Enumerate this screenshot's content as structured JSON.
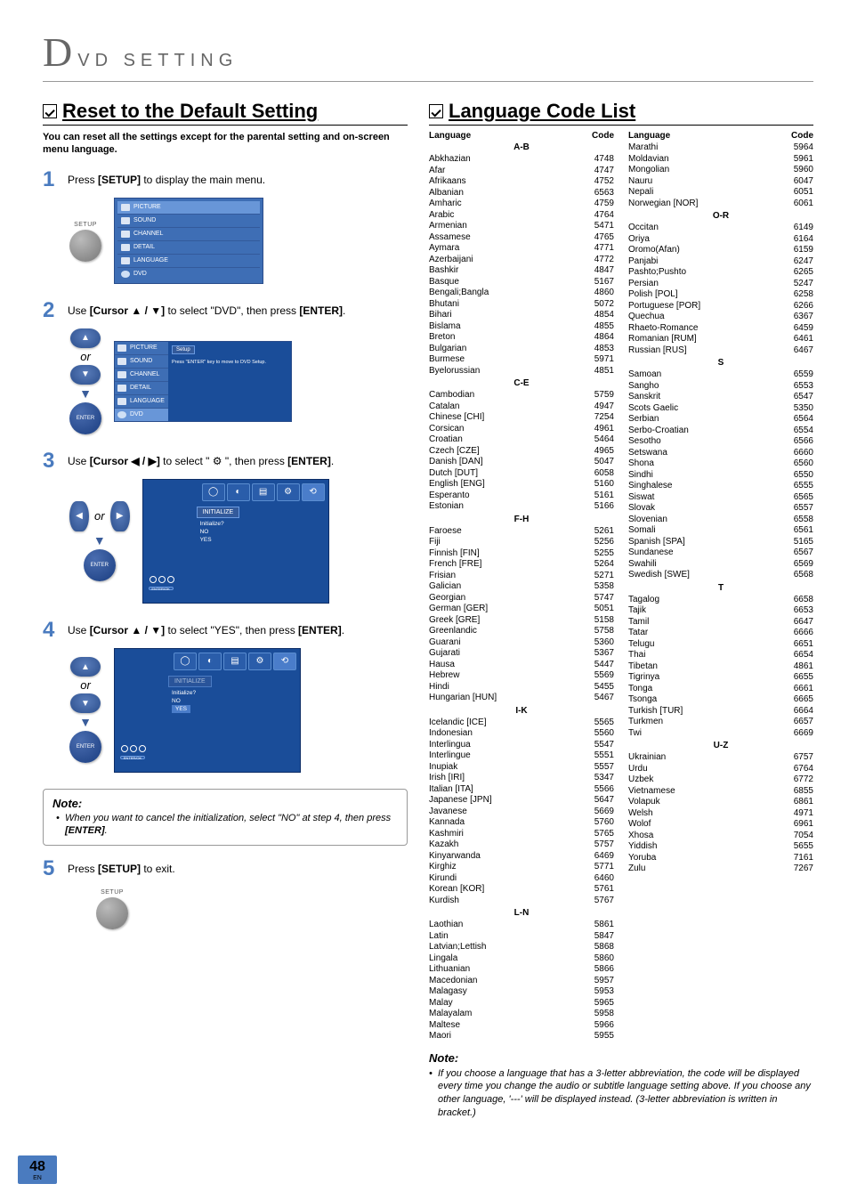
{
  "header": {
    "bigLetter": "D",
    "title": "VD   SETTING"
  },
  "leftSection": {
    "title": "Reset to the Default Setting",
    "intro": "You can reset all the settings except for the parental setting and on-screen menu language.",
    "steps": {
      "s1": {
        "num": "1",
        "text_pre": "Press ",
        "key1": "[SETUP]",
        "text_post": " to display the main menu.",
        "btnLabel": "SETUP"
      },
      "s2": {
        "num": "2",
        "text_pre": "Use ",
        "key1": "[Cursor ▲ / ▼]",
        "mid": " to select \"DVD\", then press ",
        "key2": "[ENTER]",
        "end": ".",
        "or": "or",
        "enter": "ENTER"
      },
      "s3": {
        "num": "3",
        "text_pre": "Use ",
        "key1": "[Cursor ◀ / ▶]",
        "mid": " to select \" ",
        "icon": "⚙",
        "mid2": " \", then press ",
        "key2": "[ENTER]",
        "end": ".",
        "or": "or",
        "enter": "ENTER"
      },
      "s4": {
        "num": "4",
        "text_pre": "Use ",
        "key1": "[Cursor ▲ / ▼]",
        "mid": " to select \"YES\", then press ",
        "key2": "[ENTER]",
        "end": ".",
        "or": "or",
        "enter": "ENTER"
      },
      "s5": {
        "num": "5",
        "text_pre": "Press ",
        "key1": "[SETUP]",
        "text_post": " to exit.",
        "btnLabel": "SETUP"
      }
    },
    "menu": {
      "items": [
        "PICTURE",
        "SOUND",
        "CHANNEL",
        "DETAIL",
        "LANGUAGE",
        "DVD"
      ]
    },
    "screen2": {
      "setupLabel": "Setup",
      "hint": "Press \"ENTER\" key to move to DVD Setup."
    },
    "dvdSetup": {
      "initialize": "INITIALIZE",
      "question": "Initialize?",
      "no": "NO",
      "yes": "YES",
      "enterOk": "ENTER/OK"
    },
    "note": {
      "title": "Note:",
      "item": "When you want to cancel the initialization, select \"NO\" at step 4, then press ",
      "key": "[ENTER]",
      "end": "."
    }
  },
  "rightSection": {
    "title": "Language Code List",
    "headerLang": "Language",
    "headerCode": "Code",
    "groups": {
      "col1": [
        {
          "g": "A-B"
        },
        {
          "l": "Abkhazian",
          "c": "4748"
        },
        {
          "l": "Afar",
          "c": "4747"
        },
        {
          "l": "Afrikaans",
          "c": "4752"
        },
        {
          "l": "Albanian",
          "c": "6563"
        },
        {
          "l": "Amharic",
          "c": "4759"
        },
        {
          "l": "Arabic",
          "c": "4764"
        },
        {
          "l": "Armenian",
          "c": "5471"
        },
        {
          "l": "Assamese",
          "c": "4765"
        },
        {
          "l": "Aymara",
          "c": "4771"
        },
        {
          "l": "Azerbaijani",
          "c": "4772"
        },
        {
          "l": "Bashkir",
          "c": "4847"
        },
        {
          "l": "Basque",
          "c": "5167"
        },
        {
          "l": "Bengali;Bangla",
          "c": "4860"
        },
        {
          "l": "Bhutani",
          "c": "5072"
        },
        {
          "l": "Bihari",
          "c": "4854"
        },
        {
          "l": "Bislama",
          "c": "4855"
        },
        {
          "l": "Breton",
          "c": "4864"
        },
        {
          "l": "Bulgarian",
          "c": "4853"
        },
        {
          "l": "Burmese",
          "c": "5971"
        },
        {
          "l": "Byelorussian",
          "c": "4851"
        },
        {
          "g": "C-E"
        },
        {
          "l": "Cambodian",
          "c": "5759"
        },
        {
          "l": "Catalan",
          "c": "4947"
        },
        {
          "l": "Chinese [CHI]",
          "c": "7254"
        },
        {
          "l": "Corsican",
          "c": "4961"
        },
        {
          "l": "Croatian",
          "c": "5464"
        },
        {
          "l": "Czech [CZE]",
          "c": "4965"
        },
        {
          "l": "Danish [DAN]",
          "c": "5047"
        },
        {
          "l": "Dutch [DUT]",
          "c": "6058"
        },
        {
          "l": "English [ENG]",
          "c": "5160"
        },
        {
          "l": "Esperanto",
          "c": "5161"
        },
        {
          "l": "Estonian",
          "c": "5166"
        },
        {
          "g": "F-H"
        },
        {
          "l": "Faroese",
          "c": "5261"
        },
        {
          "l": "Fiji",
          "c": "5256"
        },
        {
          "l": "Finnish [FIN]",
          "c": "5255"
        },
        {
          "l": "French [FRE]",
          "c": "5264"
        },
        {
          "l": "Frisian",
          "c": "5271"
        },
        {
          "l": "Galician",
          "c": "5358"
        },
        {
          "l": "Georgian",
          "c": "5747"
        },
        {
          "l": "German [GER]",
          "c": "5051"
        },
        {
          "l": "Greek [GRE]",
          "c": "5158"
        },
        {
          "l": "Greenlandic",
          "c": "5758"
        },
        {
          "l": "Guarani",
          "c": "5360"
        },
        {
          "l": "Gujarati",
          "c": "5367"
        },
        {
          "l": "Hausa",
          "c": "5447"
        },
        {
          "l": "Hebrew",
          "c": "5569"
        },
        {
          "l": "Hindi",
          "c": "5455"
        },
        {
          "l": "Hungarian [HUN]",
          "c": "5467"
        },
        {
          "g": "I-K"
        },
        {
          "l": "Icelandic [ICE]",
          "c": "5565"
        },
        {
          "l": "Indonesian",
          "c": "5560"
        },
        {
          "l": "Interlingua",
          "c": "5547"
        },
        {
          "l": "Interlingue",
          "c": "5551"
        },
        {
          "l": "Inupiak",
          "c": "5557"
        },
        {
          "l": "Irish [IRI]",
          "c": "5347"
        },
        {
          "l": "Italian [ITA]",
          "c": "5566"
        },
        {
          "l": "Japanese [JPN]",
          "c": "5647"
        },
        {
          "l": "Javanese",
          "c": "5669"
        },
        {
          "l": "Kannada",
          "c": "5760"
        },
        {
          "l": "Kashmiri",
          "c": "5765"
        },
        {
          "l": "Kazakh",
          "c": "5757"
        },
        {
          "l": "Kinyarwanda",
          "c": "6469"
        },
        {
          "l": "Kirghiz",
          "c": "5771"
        },
        {
          "l": "Kirundi",
          "c": "6460"
        },
        {
          "l": "Korean [KOR]",
          "c": "5761"
        },
        {
          "l": "Kurdish",
          "c": "5767"
        },
        {
          "g": "L-N"
        },
        {
          "l": "Laothian",
          "c": "5861"
        },
        {
          "l": "Latin",
          "c": "5847"
        },
        {
          "l": "Latvian;Lettish",
          "c": "5868"
        },
        {
          "l": "Lingala",
          "c": "5860"
        },
        {
          "l": "Lithuanian",
          "c": "5866"
        },
        {
          "l": "Macedonian",
          "c": "5957"
        },
        {
          "l": "Malagasy",
          "c": "5953"
        },
        {
          "l": "Malay",
          "c": "5965"
        },
        {
          "l": "Malayalam",
          "c": "5958"
        },
        {
          "l": "Maltese",
          "c": "5966"
        },
        {
          "l": "Maori",
          "c": "5955"
        }
      ],
      "col2": [
        {
          "l": "Marathi",
          "c": "5964"
        },
        {
          "l": "Moldavian",
          "c": "5961"
        },
        {
          "l": "Mongolian",
          "c": "5960"
        },
        {
          "l": "Nauru",
          "c": "6047"
        },
        {
          "l": "Nepali",
          "c": "6051"
        },
        {
          "l": "Norwegian [NOR]",
          "c": "6061"
        },
        {
          "g": "O-R"
        },
        {
          "l": "Occitan",
          "c": "6149"
        },
        {
          "l": "Oriya",
          "c": "6164"
        },
        {
          "l": "Oromo(Afan)",
          "c": "6159"
        },
        {
          "l": "Panjabi",
          "c": "6247"
        },
        {
          "l": "Pashto;Pushto",
          "c": "6265"
        },
        {
          "l": "Persian",
          "c": "5247"
        },
        {
          "l": "Polish [POL]",
          "c": "6258"
        },
        {
          "l": "Portuguese [POR]",
          "c": "6266"
        },
        {
          "l": "Quechua",
          "c": "6367"
        },
        {
          "l": "Rhaeto-Romance",
          "c": "6459"
        },
        {
          "l": "Romanian [RUM]",
          "c": "6461"
        },
        {
          "l": "Russian [RUS]",
          "c": "6467"
        },
        {
          "g": "S"
        },
        {
          "l": "Samoan",
          "c": "6559"
        },
        {
          "l": "Sangho",
          "c": "6553"
        },
        {
          "l": "Sanskrit",
          "c": "6547"
        },
        {
          "l": "Scots Gaelic",
          "c": "5350"
        },
        {
          "l": "Serbian",
          "c": "6564"
        },
        {
          "l": "Serbo-Croatian",
          "c": "6554"
        },
        {
          "l": "Sesotho",
          "c": "6566"
        },
        {
          "l": "Setswana",
          "c": "6660"
        },
        {
          "l": "Shona",
          "c": "6560"
        },
        {
          "l": "Sindhi",
          "c": "6550"
        },
        {
          "l": "Singhalese",
          "c": "6555"
        },
        {
          "l": "Siswat",
          "c": "6565"
        },
        {
          "l": "Slovak",
          "c": "6557"
        },
        {
          "l": "Slovenian",
          "c": "6558"
        },
        {
          "l": "Somali",
          "c": "6561"
        },
        {
          "l": "Spanish [SPA]",
          "c": "5165"
        },
        {
          "l": "Sundanese",
          "c": "6567"
        },
        {
          "l": "Swahili",
          "c": "6569"
        },
        {
          "l": "Swedish [SWE]",
          "c": "6568"
        },
        {
          "g": "T"
        },
        {
          "l": "Tagalog",
          "c": "6658"
        },
        {
          "l": "Tajik",
          "c": "6653"
        },
        {
          "l": "Tamil",
          "c": "6647"
        },
        {
          "l": "Tatar",
          "c": "6666"
        },
        {
          "l": "Telugu",
          "c": "6651"
        },
        {
          "l": "Thai",
          "c": "6654"
        },
        {
          "l": "Tibetan",
          "c": "4861"
        },
        {
          "l": "Tigrinya",
          "c": "6655"
        },
        {
          "l": "Tonga",
          "c": "6661"
        },
        {
          "l": "Tsonga",
          "c": "6665"
        },
        {
          "l": "Turkish [TUR]",
          "c": "6664"
        },
        {
          "l": "Turkmen",
          "c": "6657"
        },
        {
          "l": "Twi",
          "c": "6669"
        },
        {
          "g": "U-Z"
        },
        {
          "l": "Ukrainian",
          "c": "6757"
        },
        {
          "l": "Urdu",
          "c": "6764"
        },
        {
          "l": "Uzbek",
          "c": "6772"
        },
        {
          "l": "Vietnamese",
          "c": "6855"
        },
        {
          "l": "Volapuk",
          "c": "6861"
        },
        {
          "l": "Welsh",
          "c": "4971"
        },
        {
          "l": "Wolof",
          "c": "6961"
        },
        {
          "l": "Xhosa",
          "c": "7054"
        },
        {
          "l": "Yiddish",
          "c": "5655"
        },
        {
          "l": "Yoruba",
          "c": "7161"
        },
        {
          "l": "Zulu",
          "c": "7267"
        }
      ]
    },
    "note": {
      "title": "Note:",
      "item": "If you choose a language that has a 3-letter abbreviation, the code will be displayed every time you change the audio or subtitle language setting above. If you choose any other language, '---' will be displayed instead. (3-letter abbreviation is written in bracket.)"
    }
  },
  "pageNumber": {
    "num": "48",
    "en": "EN"
  }
}
